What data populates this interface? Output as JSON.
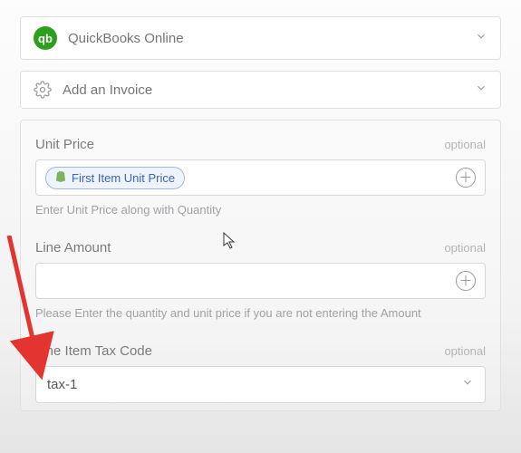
{
  "stepper": {
    "app": {
      "label": "QuickBooks Online",
      "icon_text": "qb"
    },
    "action": {
      "label": "Add an Invoice"
    }
  },
  "fields": {
    "unit_price": {
      "label": "Unit Price",
      "optional": "optional",
      "pill": "First Item Unit Price",
      "helper": "Enter Unit Price along with Quantity"
    },
    "line_amount": {
      "label": "Line Amount",
      "optional": "optional",
      "helper": "Please Enter the quantity and unit price if you are not entering the Amount"
    },
    "tax_code": {
      "label": "Line Item Tax Code",
      "optional": "optional",
      "value": "tax-1"
    }
  }
}
